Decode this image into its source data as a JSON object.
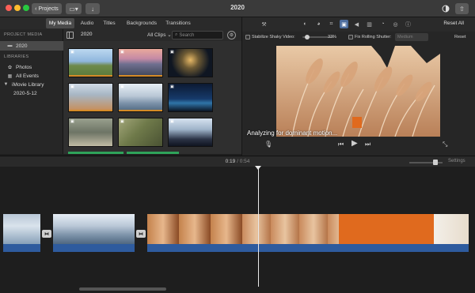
{
  "window": {
    "title": "2020",
    "projects_label": "Projects"
  },
  "tabs": [
    {
      "label": "My Media"
    },
    {
      "label": "Audio"
    },
    {
      "label": "Titles"
    },
    {
      "label": "Backgrounds"
    },
    {
      "label": "Transitions"
    }
  ],
  "sidebar": {
    "project_media_heading": "PROJECT MEDIA",
    "project_item": "2020",
    "libraries_heading": "LIBRARIES",
    "photos": "Photos",
    "all_events": "All Events",
    "library": "iMovie Library",
    "event": "2020-5-12"
  },
  "browser": {
    "folder": "2020",
    "filter": "All Clips ⌄",
    "search_placeholder": "Search"
  },
  "inspector": {
    "reset_all": "Reset All",
    "stabilize_label": "Stabilize Shaky Video:",
    "stabilize_value": "33%",
    "stabilize_level": 0.33,
    "rolling_label": "Fix Rolling Shutter:",
    "rolling_value": "Medium",
    "reset": "Reset"
  },
  "viewer": {
    "analyzing_text": "Analyzing for dominant motion..."
  },
  "timeline": {
    "current": "0:19",
    "separator": "/",
    "duration": "0:54",
    "settings_label": "Settings"
  },
  "colors": {
    "accent_blue": "#4e6e9e",
    "audio_blue": "#2e5b9e",
    "clip_orange": "#d48b28",
    "title_orange": "#e06a1e",
    "event_green": "#2fa35a"
  }
}
